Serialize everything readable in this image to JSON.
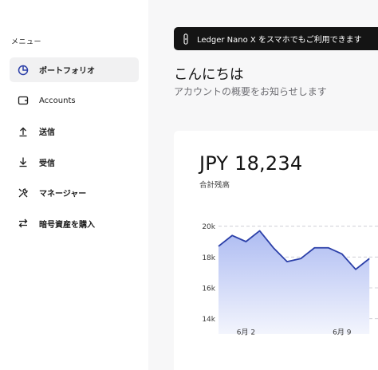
{
  "sidebar": {
    "menu_title": "メニュー",
    "items": [
      {
        "label": "ポートフォリオ",
        "icon": "portfolio-pie-icon",
        "active": true
      },
      {
        "label": "Accounts",
        "icon": "wallet-icon"
      },
      {
        "label": "送信",
        "icon": "send-arrow-up-icon"
      },
      {
        "label": "受信",
        "icon": "receive-arrow-down-icon"
      },
      {
        "label": "マネージャー",
        "icon": "tools-icon"
      },
      {
        "label": "暗号資産を購入",
        "icon": "exchange-arrows-icon"
      }
    ]
  },
  "banner": {
    "text": "Ledger Nano X をスマホでもご利用できます",
    "icon": "device-icon"
  },
  "header": {
    "greeting": "こんにちは",
    "subtitle": "アカウントの概要をお知らせします"
  },
  "summary": {
    "balance": "JPY 18,234",
    "balance_label": "合計残高"
  },
  "colors": {
    "accent": "#2b3fa8",
    "fill_top": "#aebcf2",
    "fill_bottom": "#f3f5fd",
    "banner_bg": "#141414",
    "sidebar_active_bg": "#f1f1f2"
  },
  "chart_data": {
    "type": "area",
    "ylim": [
      13000,
      20500
    ],
    "y_ticks": [
      {
        "value": 20000,
        "label": "20k"
      },
      {
        "value": 18000,
        "label": "18k"
      },
      {
        "value": 16000,
        "label": "16k"
      },
      {
        "value": 14000,
        "label": "14k"
      }
    ],
    "x_ticks": [
      {
        "index": 2,
        "label": "6月 2"
      },
      {
        "index": 9,
        "label": "6月 9"
      }
    ],
    "grid": true,
    "series": [
      {
        "values": [
          18700,
          19400,
          19000,
          19700,
          18600,
          17700,
          17900,
          18600,
          18600,
          18200,
          17200,
          17900
        ]
      }
    ]
  }
}
